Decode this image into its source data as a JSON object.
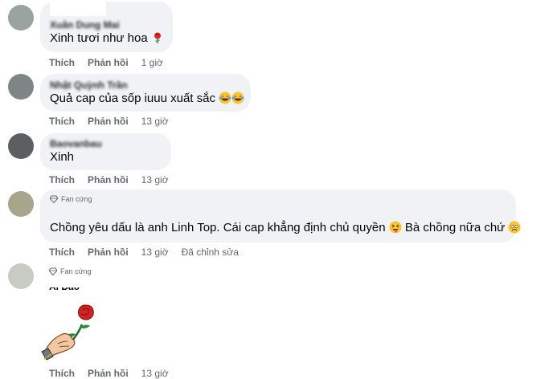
{
  "action_labels": {
    "like": "Thích",
    "reply": "Phản hồi",
    "edited": "Đã chỉnh sửa"
  },
  "comments": [
    {
      "author": "Xuân Dung Mai",
      "text": "Xinh tươi như hoa",
      "emoji": "rose",
      "time": "1 giờ"
    },
    {
      "author": "Nhật Quỳnh Trần",
      "text": "Quả cap của sốp iuuu xuất sắc",
      "emoji": "laughing-crying x2",
      "time": "13 giờ"
    },
    {
      "author": "Baovanbau",
      "text": "Xinh",
      "time": "13 giờ"
    },
    {
      "badge": "Fan cứng",
      "text_part1": "Chồng yêu dấu là anh Linh Top. Cái cap khẳng định chủ quyền",
      "text_part2": "Bà chồng nữa chứ",
      "time": "13 giờ",
      "edited": true
    },
    {
      "badge": "Fan cứng",
      "author": "Ái Đào",
      "sticker": "hand-holding-rose",
      "time": "13 giờ"
    }
  ],
  "colors": {
    "bubble": "#f0f2f5",
    "meta": "#65676b",
    "text": "#050505"
  }
}
